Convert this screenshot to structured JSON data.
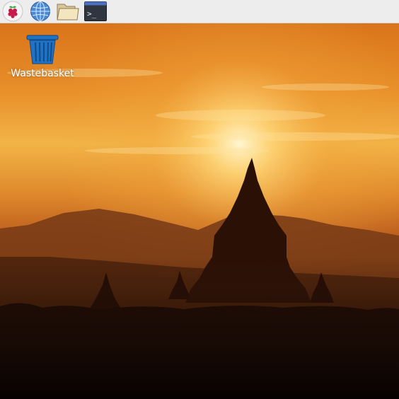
{
  "taskbar": {
    "launchers": [
      {
        "icon": "raspberry-menu-icon"
      },
      {
        "icon": "web-browser-globe-icon"
      },
      {
        "icon": "file-manager-folder-icon"
      },
      {
        "icon": "terminal-icon",
        "glyph": ">_"
      }
    ]
  },
  "desktop": {
    "icons": [
      {
        "label": "Wastebasket",
        "icon": "wastebasket-icon"
      }
    ]
  },
  "colors": {
    "taskbar_bg": "#ededed",
    "sky_top": "#e07e1c",
    "sun_glow": "#fff1b8",
    "hills": "#5a2d10",
    "foreground": "#0c0503",
    "trash_blue": "#1f72c4"
  }
}
